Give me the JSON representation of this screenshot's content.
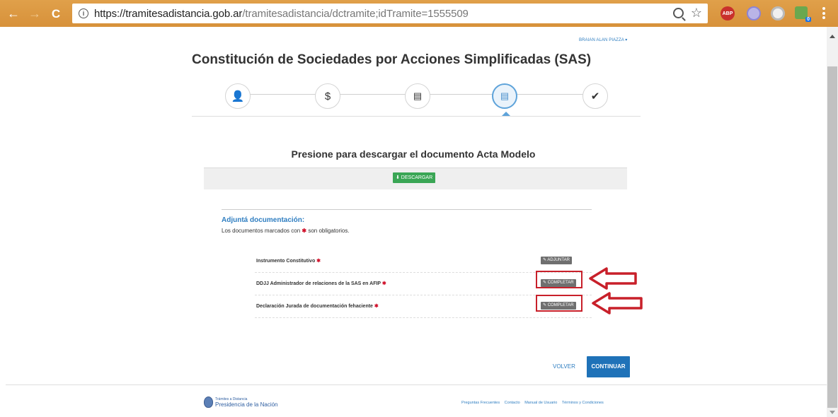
{
  "browser": {
    "url_host": "https://tramitesadistancia.gob.ar",
    "url_path": "/tramitesadistancia/dctramite;idTramite=1555509",
    "nav": {
      "back": "←",
      "forward": "→",
      "reload": "C"
    },
    "extensions": {
      "abp": "ABP",
      "badge": "0"
    }
  },
  "header": {
    "user_menu": "BRAIAN ALAN PIAZZA ▾"
  },
  "page": {
    "title": "Constitución de Sociedades por Acciones Simplificadas (SAS)"
  },
  "stepper": {
    "steps": [
      {
        "icon": "user-icon",
        "glyph": "👤",
        "state": "done"
      },
      {
        "icon": "dollar-icon",
        "glyph": "$",
        "state": "done"
      },
      {
        "icon": "form-icon",
        "glyph": "▤",
        "state": "done"
      },
      {
        "icon": "form-icon",
        "glyph": "▤",
        "state": "active"
      },
      {
        "icon": "check-icon",
        "glyph": "✔",
        "state": "pending"
      }
    ]
  },
  "download": {
    "title": "Presione para descargar el documento Acta Modelo",
    "button_label": "⬇ DESCARGAR"
  },
  "documents": {
    "title": "Adjuntá documentación:",
    "note_before": "Los documentos marcados con",
    "note_mark": "✱",
    "note_after": "son obligatorios.",
    "required_mark": "✱",
    "items": [
      {
        "label": "Instrumento Constitutivo",
        "action": "✎ ADJUNTAR",
        "highlighted": false
      },
      {
        "label": "DDJJ Administrador de relaciones de la SAS en AFIP",
        "action": "✎ COMPLETAR",
        "highlighted": true
      },
      {
        "label": "Declaración Jurada de documentación fehaciente",
        "action": "✎ COMPLETAR",
        "highlighted": true
      }
    ]
  },
  "actions": {
    "back_label": "VOLVER",
    "continue_label": "CONTINUAR"
  },
  "footer": {
    "brand_line1": "Trámites a Distancia",
    "brand_line2": "Presidencia de la Nación",
    "links": [
      "Preguntas Frecuentes",
      "Contacto",
      "Manual de Usuario",
      "Términos y Condiciones"
    ]
  },
  "colors": {
    "browser_toolbar": "#d7913a",
    "link_blue": "#2f7ec1",
    "primary_button": "#1f72b8",
    "download_button": "#3aa655",
    "required_red": "#d0102a",
    "annotation_red": "#c8202a"
  }
}
